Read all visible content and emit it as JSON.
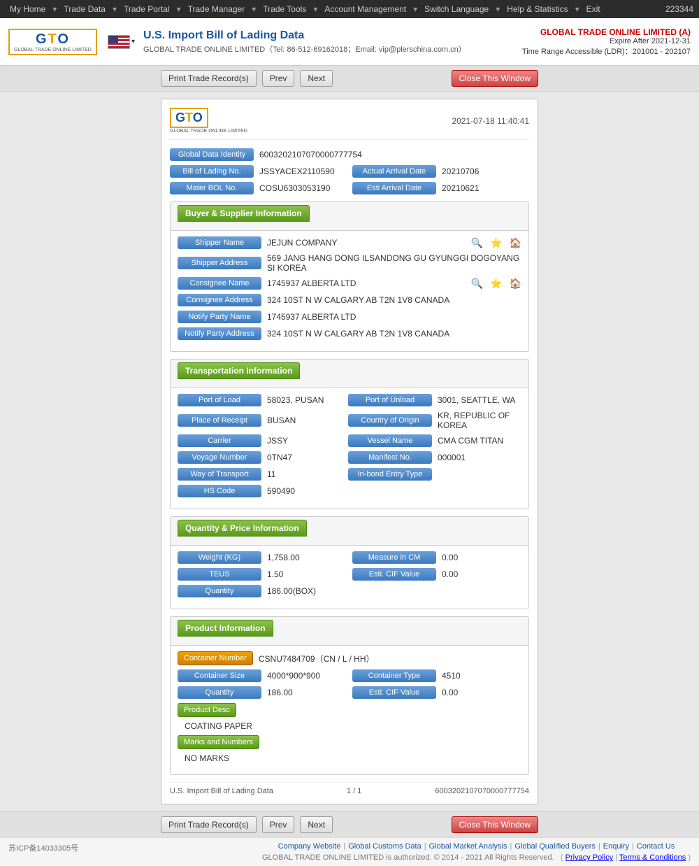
{
  "topnav": {
    "items": [
      {
        "label": "My Home",
        "id": "my-home"
      },
      {
        "label": "Trade Data",
        "id": "trade-data"
      },
      {
        "label": "Trade Portal",
        "id": "trade-portal"
      },
      {
        "label": "Trade Manager",
        "id": "trade-manager"
      },
      {
        "label": "Trade Tools",
        "id": "trade-tools"
      },
      {
        "label": "Account Management",
        "id": "account-management"
      },
      {
        "label": "Switch Language",
        "id": "switch-language"
      },
      {
        "label": "Help & Statistics",
        "id": "help-statistics"
      },
      {
        "label": "Exit",
        "id": "exit"
      }
    ],
    "account_id": "223344"
  },
  "header": {
    "title": "U.S. Import Bill of Lading Data",
    "subtitle": "GLOBAL TRADE ONLINE LIMITED（Tel: 86-512-69162018；Email: vip@plerschina.com.cn）",
    "account_name": "GLOBAL TRADE ONLINE LIMITED (A)",
    "expire_label": "Expire After 2021-12-31",
    "range_label": "Time Range Accessible (LDR)：201001 - 202107"
  },
  "toolbar": {
    "print_label": "Print Trade Record(s)",
    "prev_label": "Prev",
    "next_label": "Next",
    "close_label": "Close This Window"
  },
  "card": {
    "timestamp": "2021-07-18 11:40:41",
    "global_data_identity_label": "Global Data Identity",
    "global_data_identity_value": "6003202107070000777754",
    "bill_of_lading_no_label": "Bill of Lading No.",
    "bill_of_lading_no_value": "JSSYACEX2110590",
    "actual_arrival_date_label": "Actual Arrival Date",
    "actual_arrival_date_value": "20210706",
    "mater_bol_no_label": "Mater BOL No.",
    "mater_bol_no_value": "COSU6303053190",
    "esti_arrival_date_label": "Esti Arrival Date",
    "esti_arrival_date_value": "20210621",
    "sections": {
      "buyer_supplier": {
        "title": "Buyer & Supplier Information",
        "fields": [
          {
            "label": "Shipper Name",
            "value": "JEJUN COMPANY",
            "has_icons": true
          },
          {
            "label": "Shipper Address",
            "value": "569 JANG HANG DONG ILSANDONG GU GYUNGGI DOGOYANG SI KOREA"
          },
          {
            "label": "Consignee Name",
            "value": "1745937 ALBERTA LTD",
            "has_icons": true
          },
          {
            "label": "Consignee Address",
            "value": "324 10ST N W CALGARY AB T2N 1V8 CANADA"
          },
          {
            "label": "Notify Party Name",
            "value": "1745937 ALBERTA LTD"
          },
          {
            "label": "Notify Party Address",
            "value": "324 10ST N W CALGARY AB T2N 1V8 CANADA"
          }
        ]
      },
      "transportation": {
        "title": "Transportation Information",
        "fields_left": [
          {
            "label": "Port of Load",
            "value": "58023, PUSAN"
          },
          {
            "label": "Place of Receipt",
            "value": "BUSAN"
          },
          {
            "label": "Carrier",
            "value": "JSSY"
          },
          {
            "label": "Voyage Number",
            "value": "0TN47"
          },
          {
            "label": "Way of Transport",
            "value": "11"
          },
          {
            "label": "HS Code",
            "value": "590490"
          }
        ],
        "fields_right": [
          {
            "label": "Port of Unload",
            "value": "3001, SEATTLE, WA"
          },
          {
            "label": "Country of Origin",
            "value": "KR, REPUBLIC OF KOREA"
          },
          {
            "label": "Vessel Name",
            "value": "CMA CGM TITAN"
          },
          {
            "label": "Manifest No.",
            "value": "000001"
          },
          {
            "label": "In-bond Entry Type",
            "value": ""
          }
        ]
      },
      "quantity_price": {
        "title": "Quantity & Price Information",
        "fields": [
          {
            "label_left": "Weight (KG)",
            "value_left": "1,758.00",
            "label_right": "Measure in CM",
            "value_right": "0.00"
          },
          {
            "label_left": "TEUS",
            "value_left": "1.50",
            "label_right": "Esti. CIF Value",
            "value_right": "0.00"
          },
          {
            "label_left": "Quantity",
            "value_left": "186.00(BOX)",
            "label_right": null,
            "value_right": null
          }
        ]
      },
      "product": {
        "title": "Product Information",
        "container_number_label": "Container Number",
        "container_number_value": "CSNU7484709（CN / L / HH）",
        "container_size_label": "Container Size",
        "container_size_value": "4000*900*900",
        "container_type_label": "Container Type",
        "container_type_value": "4510",
        "quantity_label": "Quantity",
        "quantity_value": "186.00",
        "esti_cif_label": "Esti. CIF Value",
        "esti_cif_value": "0.00",
        "product_desc_label": "Product Desc",
        "product_desc_value": "COATING PAPER",
        "marks_numbers_label": "Marks and Numbers",
        "marks_numbers_value": "NO MARKS"
      }
    },
    "footer": {
      "left": "U.S. Import Bill of Lading Data",
      "center": "1 / 1",
      "right": "6003202107070000777754"
    }
  },
  "bottom_toolbar": {
    "print_label": "Print Trade Record(s)",
    "prev_label": "Prev",
    "next_label": "Next",
    "close_label": "Close This Window"
  },
  "page_footer": {
    "icp": "苏ICP备14033305号",
    "links": [
      "Company Website",
      "Global Customs Data",
      "Global Market Analysis",
      "Global Qualified Buyers",
      "Enquiry",
      "Contact Us"
    ],
    "copyright": "GLOBAL TRADE ONLINE LIMITED is authorized. © 2014 - 2021 All Rights Reserved.",
    "privacy_label": "Privacy Policy",
    "terms_label": "Terms & Conditions"
  }
}
